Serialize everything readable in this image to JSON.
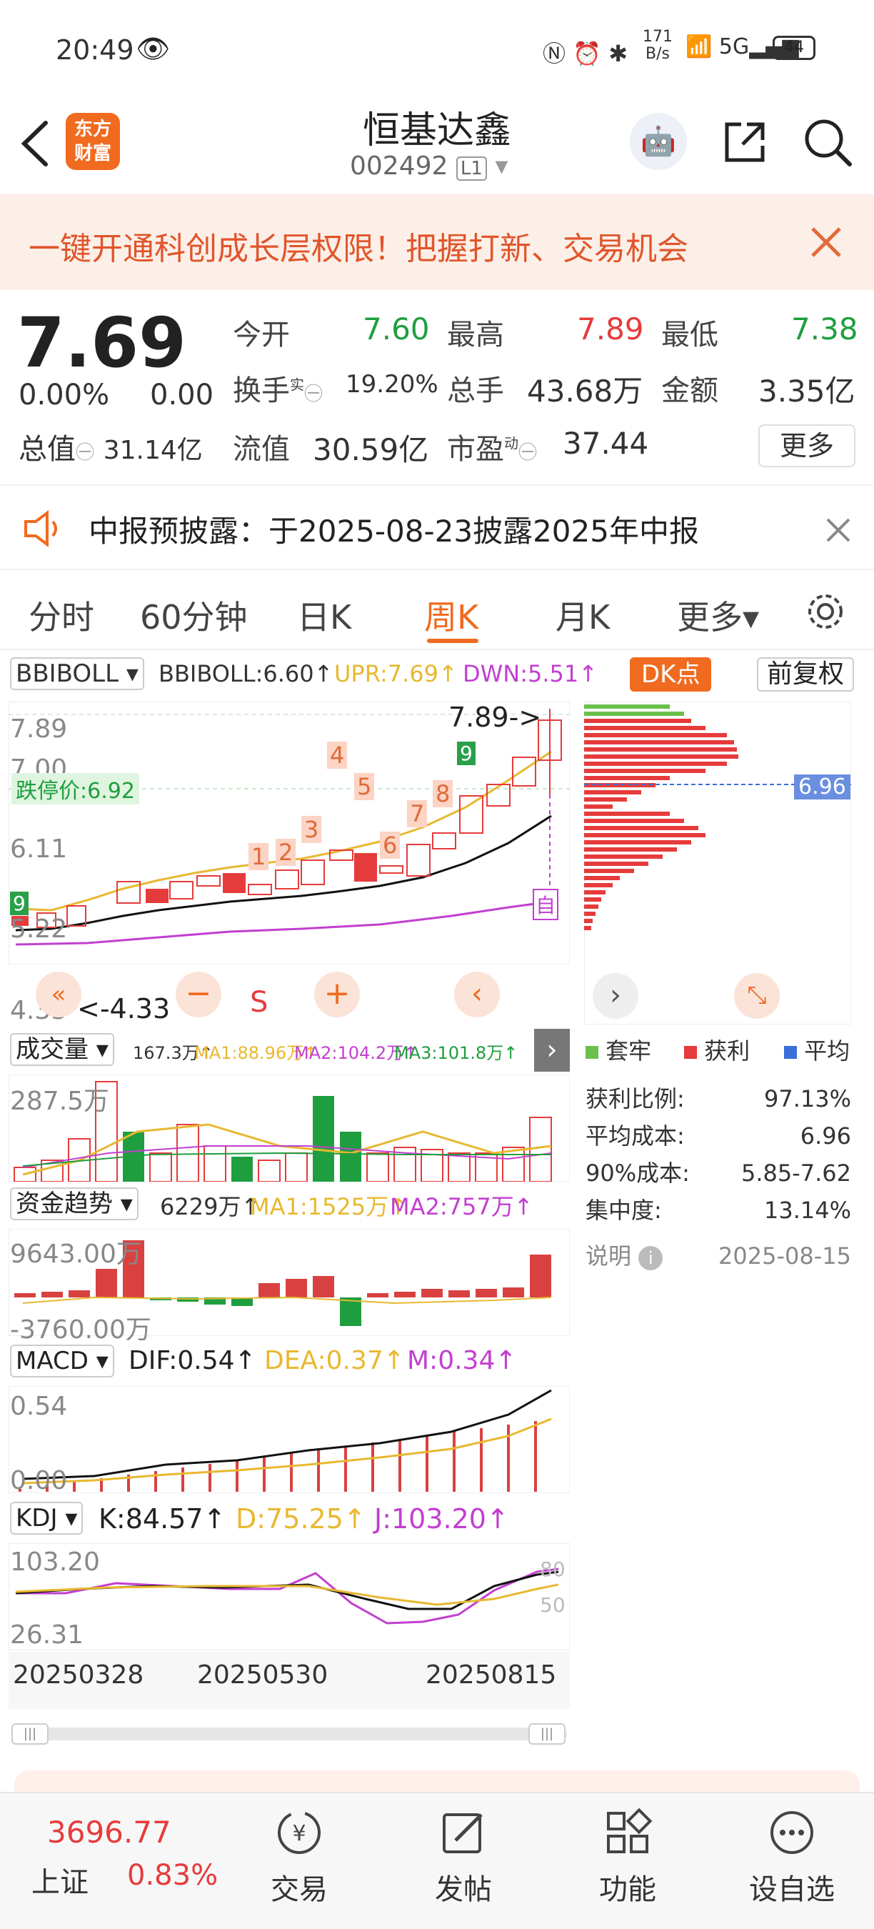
{
  "status": {
    "time": "20:49",
    "net_speed": "171",
    "net_unit": "B/s",
    "battery": "44"
  },
  "header": {
    "brand_line1": "东方",
    "brand_line2": "财富",
    "stock_name": "恒基达鑫",
    "stock_code": "002492",
    "level": "L1"
  },
  "banner": {
    "text": "一键开通科创成长层权限！把握打新、交易机会"
  },
  "quote": {
    "price": "7.69",
    "change_pct": "0.00%",
    "change": "0.00",
    "open_label": "今开",
    "open": "7.60",
    "high_label": "最高",
    "high": "7.89",
    "low_label": "最低",
    "low": "7.38",
    "turnover_label": "换手",
    "turnover_sup": "实",
    "turnover": "19.20%",
    "volume_label": "总手",
    "volume": "43.68万",
    "amount_label": "金额",
    "amount": "3.35亿",
    "mktcap_label": "总值",
    "mktcap": "31.14亿",
    "float_label": "流值",
    "float_cap": "30.59亿",
    "pe_label": "市盈",
    "pe_sup": "动",
    "pe": "37.44",
    "more": "更多"
  },
  "notice": {
    "text": "中报预披露：于2025-08-23披露2025年中报"
  },
  "tabs": [
    "分时",
    "60分钟",
    "日K",
    "周K",
    "月K",
    "更多▾"
  ],
  "active_tab": 3,
  "main_chart": {
    "indicator": "BBIBOLL",
    "boll": "BBIBOLL:6.60↑",
    "upr": "UPR:7.69↑",
    "dwn": "DWN:5.51↑",
    "dk": "DK点",
    "adjust": "前复权",
    "yticks": [
      "7.89",
      "7.00",
      "6.11",
      "5.22",
      "4.33"
    ],
    "limit_price": "跌停价:6.92",
    "high_marker": "7.89->",
    "low_marker": "<-4.33",
    "nine": "9",
    "self": "自",
    "s_marker": "S",
    "counts": [
      "1",
      "2",
      "3",
      "4",
      "5",
      "6",
      "7",
      "8"
    ]
  },
  "chip": {
    "price_tag": "6.96",
    "legend": [
      "套牢",
      "获利",
      "平均"
    ],
    "rows": [
      {
        "label": "获利比例:",
        "value": "97.13%"
      },
      {
        "label": "平均成本:",
        "value": "6.96"
      },
      {
        "label": "90%成本:",
        "value": "5.85-7.62"
      },
      {
        "label": "集中度:",
        "value": "13.14%"
      }
    ],
    "note": "说明",
    "date": "2025-08-15"
  },
  "volume_panel": {
    "name": "成交量",
    "vol": "167.3万↑",
    "ma1": "MA1:88.96万↑",
    "ma2": "MA2:104.2万↑",
    "ma3": "MA3:101.8万↑",
    "ytick": "287.5万"
  },
  "fund_panel": {
    "name": "资金趋势",
    "v": "6229万↑",
    "ma1": "MA1:1525万↑",
    "ma2": "MA2:757万↑",
    "ytop": "9643.00万",
    "ybottom": "-3760.00万"
  },
  "macd_panel": {
    "name": "MACD",
    "dif": "DIF:0.54↑",
    "dea": "DEA:0.37↑",
    "m": "M:0.34↑",
    "ytop": "0.54",
    "ybottom": "0.00"
  },
  "kdj_panel": {
    "name": "KDJ",
    "k": "K:84.57↑",
    "d": "D:75.25↑",
    "j": "J:103.20↑",
    "ytop": "103.20",
    "ybottom": "26.31",
    "r80": "80",
    "r50": "50"
  },
  "dates": [
    "20250328",
    "20250530",
    "20250815"
  ],
  "index": {
    "value": "3696.77",
    "name": "上证",
    "pct": "0.83%"
  },
  "nav": [
    "交易",
    "发帖",
    "功能",
    "设自选"
  ],
  "colors": {
    "up": "#e63b3b",
    "down": "#1f9e3f",
    "accent": "#f06a1f",
    "ma_yellow": "#e8b830",
    "ma_purple": "#c23fd0"
  }
}
